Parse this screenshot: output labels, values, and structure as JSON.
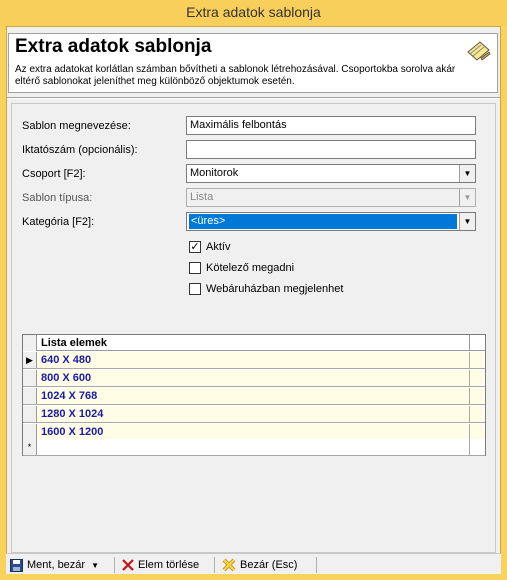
{
  "window": {
    "title": "Extra adatok sablonja"
  },
  "header": {
    "title": "Extra adatok sablonja",
    "description": "Az extra adatokat korlátlan számban bővítheti a sablonok létrehozásával. Csoportokba sorolva akár eltérő sablonokat jeleníthet meg különböző objektumok esetén.",
    "icon": "notebook-pencil-icon"
  },
  "form": {
    "name_label": "Sablon megnevezése:",
    "name_value": "Maximális felbontás",
    "filing_label": "Iktatószám (opcionális):",
    "filing_value": "",
    "group_label": "Csoport [F2]:",
    "group_value": "Monitorok",
    "type_label": "Sablon típusa:",
    "type_value": "Lista",
    "category_label": "Kategória [F2]:",
    "category_value": "<üres>",
    "active_label": "Aktív",
    "active_checked": true,
    "required_label": "Kötelező megadni",
    "required_checked": false,
    "webshop_label": "Webáruházban megjelenhet",
    "webshop_checked": false
  },
  "grid": {
    "column": "Lista elemek",
    "rows": [
      "640 X 480",
      "800 X 600",
      "1024 X 768",
      "1280 X 1024",
      "1600 X 1200"
    ],
    "new_row_marker": "*"
  },
  "toolbar": {
    "save_label": "Ment, bezár",
    "delete_label": "Elem törlése",
    "close_label": "Bezár (Esc)"
  },
  "colors": {
    "titlebar": "#f7cf5a",
    "grid_row": "#fffde6",
    "grid_text": "#1a1aa8",
    "selection": "#0078d7"
  }
}
